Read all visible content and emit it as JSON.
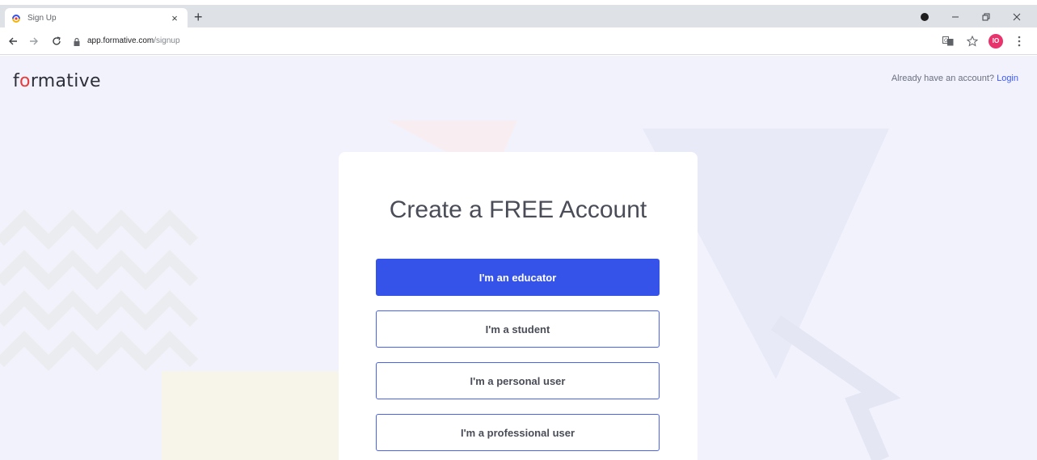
{
  "browser": {
    "tab_title": "Sign Up",
    "tab_close": "×",
    "new_tab": "+",
    "url_host": "app.formative.com",
    "url_path": "/signup",
    "avatar_initials": "IO"
  },
  "header": {
    "logo_prefix": "f",
    "logo_o": "o",
    "logo_suffix": "rmative",
    "login_prompt": "Already have an account?",
    "login_link": "Login"
  },
  "card": {
    "title": "Create a FREE Account",
    "buttons": [
      {
        "label": "I'm an educator"
      },
      {
        "label": "I'm a student"
      },
      {
        "label": "I'm a personal user"
      },
      {
        "label": "I'm a professional user"
      }
    ]
  },
  "colors": {
    "primary": "#3553e8",
    "background": "#f1f2fb",
    "logo_accent": "#e53d3d"
  }
}
